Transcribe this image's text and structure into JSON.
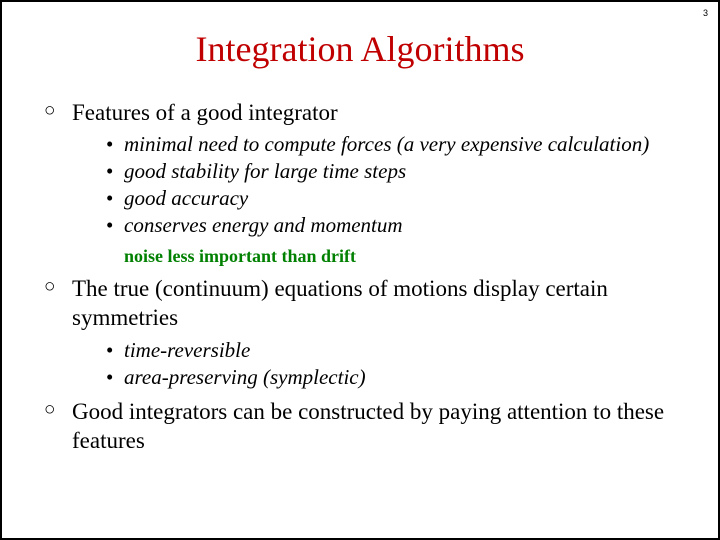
{
  "page_number": "3",
  "title": "Integration Algorithms",
  "points": [
    {
      "text": "Features of a good integrator",
      "sub": [
        "minimal need to compute forces (a very expensive calculation)",
        "good stability for large time steps",
        "good accuracy",
        "conserves energy and momentum"
      ],
      "note": "noise less important than drift"
    },
    {
      "text": "The true (continuum) equations of motions display certain symmetries",
      "sub": [
        "time-reversible",
        "area-preserving (symplectic)"
      ]
    },
    {
      "text": "Good integrators can be constructed by paying attention to these features"
    }
  ]
}
